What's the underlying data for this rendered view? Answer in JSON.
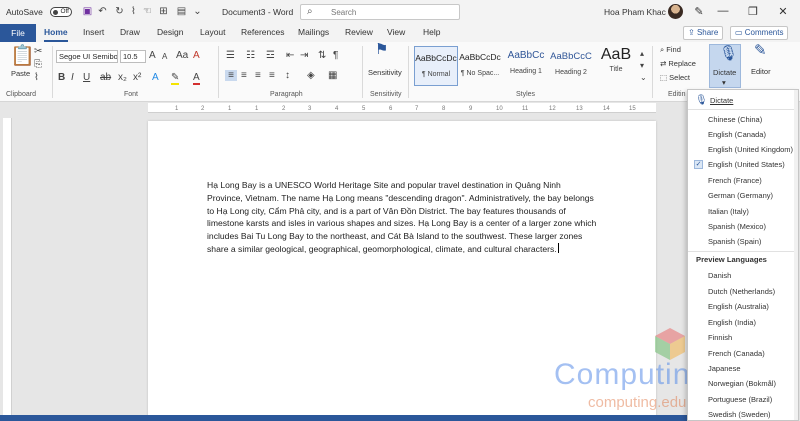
{
  "titlebar": {
    "autosave_label": "AutoSave",
    "autosave_state": "Off",
    "doc_title": "Document3 - Word",
    "search_placeholder": "Search",
    "user_name": "Hoa Pham Khac"
  },
  "tabs": {
    "file": "File",
    "items": [
      "Home",
      "Insert",
      "Draw",
      "Design",
      "Layout",
      "References",
      "Mailings",
      "Review",
      "View",
      "Help"
    ],
    "active": "Home",
    "share": "Share",
    "comments": "Comments"
  },
  "ribbon": {
    "clipboard": {
      "paste": "Paste",
      "label": "Clipboard"
    },
    "font": {
      "name": "Segoe UI Semibo",
      "size": "10.5",
      "label": "Font"
    },
    "paragraph": {
      "label": "Paragraph"
    },
    "sensitivity": {
      "button": "Sensitivity",
      "label": "Sensitivity"
    },
    "styles": {
      "label": "Styles",
      "items": [
        {
          "preview": "AaBbCcDc",
          "name": "¶ Normal"
        },
        {
          "preview": "AaBbCcDc",
          "name": "¶ No Spac..."
        },
        {
          "preview": "AaBbCc",
          "name": "Heading 1"
        },
        {
          "preview": "AaBbCcC",
          "name": "Heading 2"
        },
        {
          "preview": "AaB",
          "name": "Title"
        }
      ]
    },
    "editing": {
      "find": "Find",
      "replace": "Replace",
      "select": "Select",
      "label": "Editin"
    },
    "voice": {
      "dictate": "Dictate"
    },
    "editor": {
      "editor": "Editor"
    }
  },
  "ruler": {
    "ticks": [
      "1",
      "2",
      "1",
      "1",
      "2",
      "3",
      "4",
      "5",
      "6",
      "7",
      "8",
      "9",
      "10",
      "11",
      "12",
      "13",
      "14",
      "15"
    ]
  },
  "document": {
    "text": "Hạ Long Bay is a UNESCO World Heritage Site and popular travel destination in Quảng Ninh Province, Vietnam. The name Hạ Long means \"descending dragon\". Administratively, the bay belongs to Hạ Long city, Cẩm Phả city, and is a part of Vân Đồn District. The bay features thousands of limestone karsts and isles in various shapes and sizes. Hạ Long Bay is a center of a larger zone which includes Bai Tu Long Bay to the northeast, and Cát Bà Island to the southwest. These larger zones share a similar geological, geographical, geomorphological, climate, and cultural characters."
  },
  "dictate_menu": {
    "title": "Dictate",
    "languages": [
      "Chinese (China)",
      "English (Canada)",
      "English (United Kingdom)",
      "English (United States)",
      "French (France)",
      "German (Germany)",
      "Italian (Italy)",
      "Spanish (Mexico)",
      "Spanish (Spain)"
    ],
    "checked": "English (United States)",
    "preview_header": "Preview Languages",
    "preview": [
      "Danish",
      "Dutch (Netherlands)",
      "English (Australia)",
      "English (India)",
      "Finnish",
      "French (Canada)",
      "Japanese",
      "Norwegian (Bokmål)",
      "Portuguese (Brazil)",
      "Swedish (Sweden)"
    ]
  },
  "watermark": {
    "brand": "Computing",
    "url": "computing.edu.vn"
  },
  "colors": {
    "accent": "#2b579a",
    "status_bar": "#2b579a"
  }
}
